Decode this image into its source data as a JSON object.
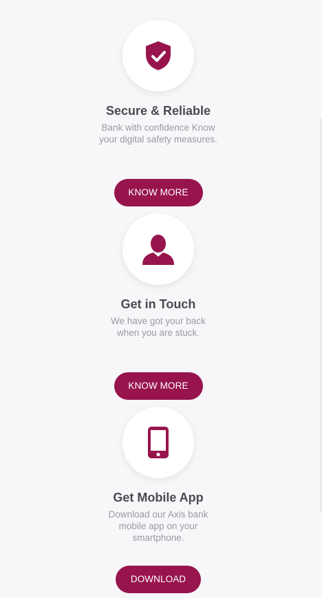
{
  "colors": {
    "accent": "#97144d",
    "background": "#f7f6f9",
    "title": "#4b4b4f",
    "description": "#9b9a9f"
  },
  "cards": [
    {
      "icon": "shield-check-icon",
      "title": "Secure & Reliable",
      "description": "Bank with confidence Know your digital safety measures.",
      "button_label": "KNOW MORE"
    },
    {
      "icon": "user-icon",
      "title": "Get in Touch",
      "description": "We have got your back when you are stuck.",
      "button_label": "KNOW MORE"
    },
    {
      "icon": "mobile-phone-icon",
      "title": "Get Mobile App",
      "description": "Download our Axis bank mobile app on your smartphone.",
      "button_label": "DOWNLOAD"
    }
  ]
}
